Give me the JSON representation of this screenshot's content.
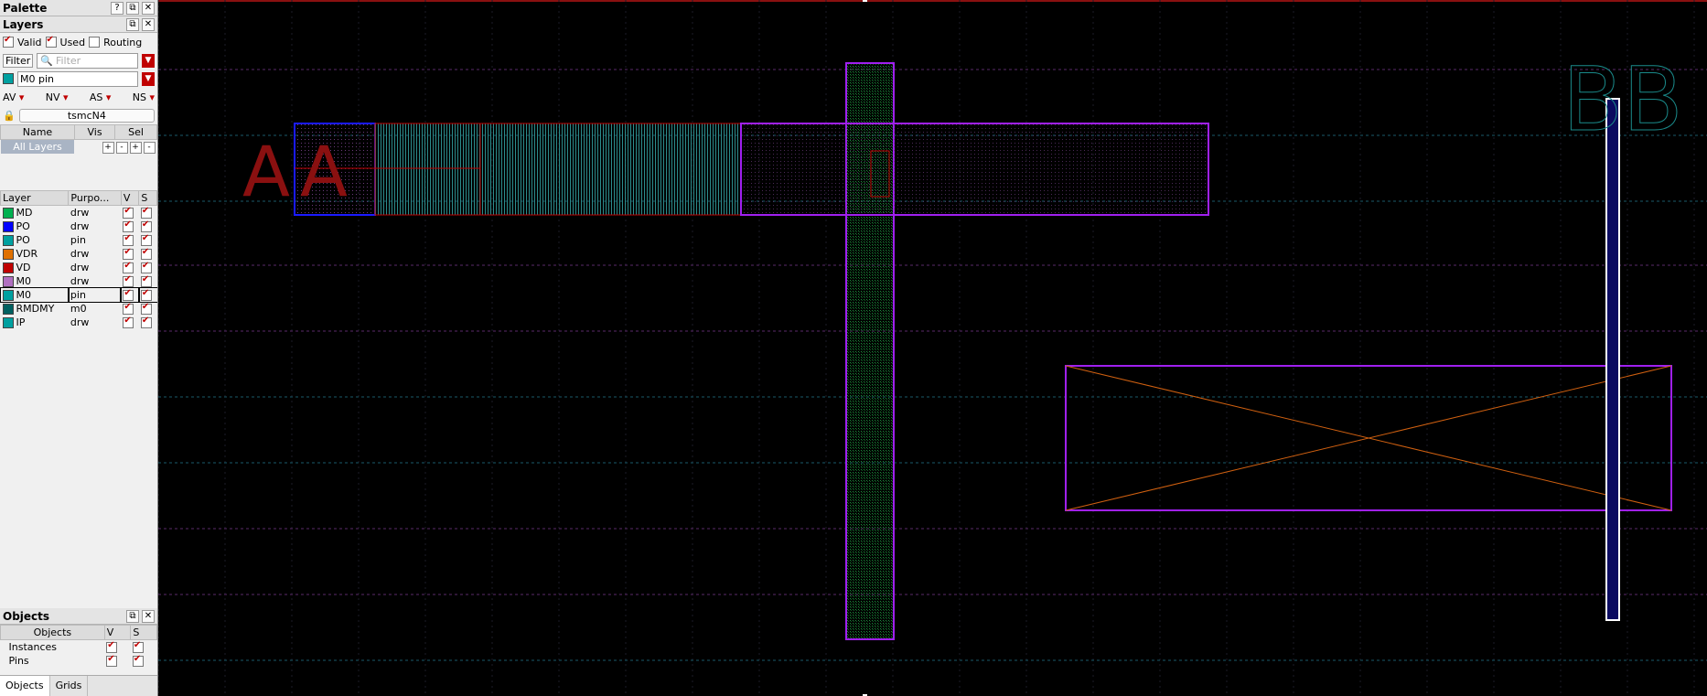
{
  "palette": {
    "title": "Palette"
  },
  "layers_panel": {
    "title": "Layers",
    "filters": [
      {
        "label": "Valid",
        "checked": true
      },
      {
        "label": "Used",
        "checked": true
      },
      {
        "label": "Routing",
        "checked": false
      }
    ],
    "filter_button": "Filter",
    "filter_placeholder": "Filter",
    "current_layer": "M0 pin",
    "vis_buttons": [
      "AV",
      "NV",
      "AS",
      "NS"
    ],
    "techlib": "tsmcN4",
    "lpp_headers": {
      "name": "Name",
      "vis": "Vis",
      "sel": "Sel"
    },
    "all_layers": "All Layers",
    "layer_headers": {
      "layer": "Layer",
      "purpose": "Purpo...",
      "v": "V",
      "s": "S"
    },
    "layers": [
      {
        "layer": "MD",
        "purpose": "drw",
        "color": "#00b050"
      },
      {
        "layer": "PO",
        "purpose": "drw",
        "color": "#0000ff"
      },
      {
        "layer": "PO",
        "purpose": "pin",
        "color": "#00a0a0"
      },
      {
        "layer": "VDR",
        "purpose": "drw",
        "color": "#e07000"
      },
      {
        "layer": "VD",
        "purpose": "drw",
        "color": "#c00000"
      },
      {
        "layer": "M0",
        "purpose": "drw",
        "color": "#b070c0"
      },
      {
        "layer": "M0",
        "purpose": "pin",
        "color": "#00a0a0"
      },
      {
        "layer": "RMDMY",
        "purpose": "m0",
        "color": "#006060"
      },
      {
        "layer": "IP",
        "purpose": "drw",
        "color": "#00a0a0"
      }
    ]
  },
  "objects_panel": {
    "title": "Objects",
    "headers": {
      "objects": "Objects",
      "v": "V",
      "s": "S"
    },
    "items": [
      "Instances",
      "Pins"
    ]
  },
  "tabs": [
    "Objects",
    "Grids"
  ],
  "canvas": {
    "labels": {
      "left": "A",
      "inner": "A",
      "right": "BB"
    }
  }
}
